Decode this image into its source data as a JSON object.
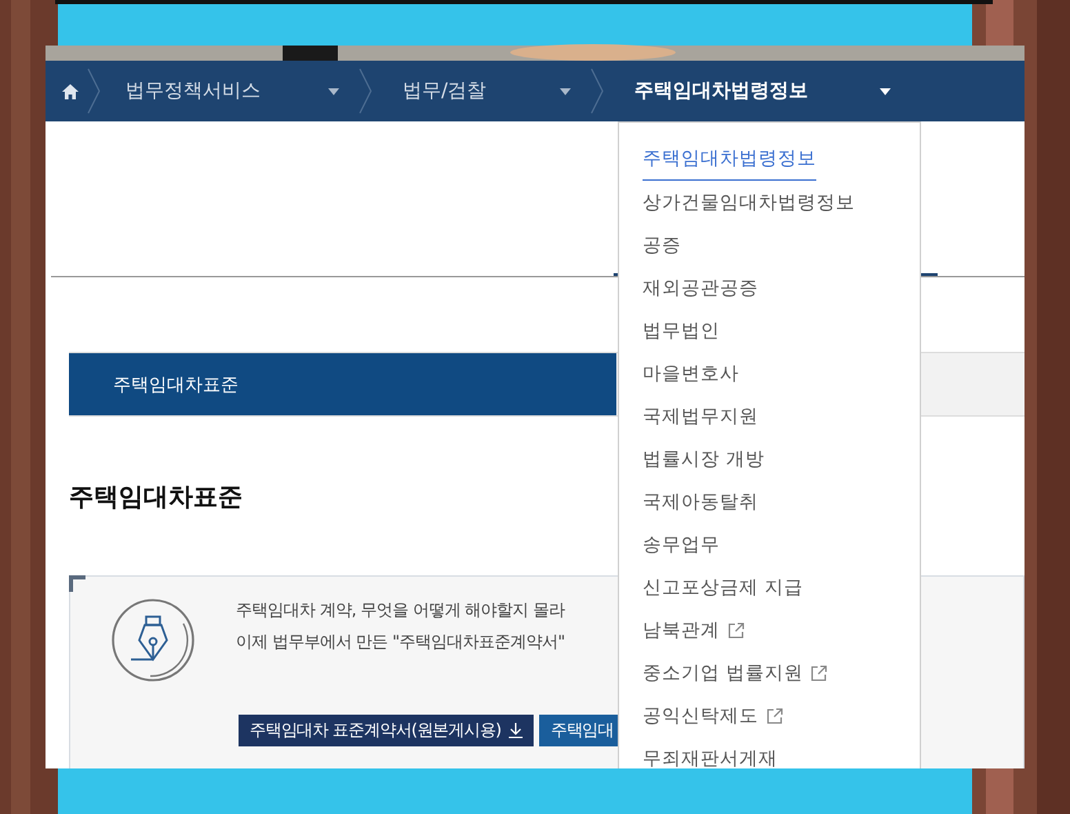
{
  "nav": {
    "items": [
      {
        "label": "법무정책서비스",
        "selected": false
      },
      {
        "label": "법무/검찰",
        "selected": false
      },
      {
        "label": "주택임대차법령정보",
        "selected": true
      }
    ]
  },
  "dropdown": {
    "items": [
      {
        "label": "주택임대차법령정보",
        "selected": true,
        "external": false
      },
      {
        "label": "상가건물임대차법령정보",
        "selected": false,
        "external": false
      },
      {
        "label": "공증",
        "selected": false,
        "external": false
      },
      {
        "label": "재외공관공증",
        "selected": false,
        "external": false
      },
      {
        "label": "법무법인",
        "selected": false,
        "external": false
      },
      {
        "label": "마을변호사",
        "selected": false,
        "external": false
      },
      {
        "label": "국제법무지원",
        "selected": false,
        "external": false
      },
      {
        "label": "법률시장 개방",
        "selected": false,
        "external": false
      },
      {
        "label": "국제아동탈취",
        "selected": false,
        "external": false
      },
      {
        "label": "송무업무",
        "selected": false,
        "external": false
      },
      {
        "label": "신고포상금제 지급",
        "selected": false,
        "external": false
      },
      {
        "label": "남북관계",
        "selected": false,
        "external": true
      },
      {
        "label": "중소기업 법률지원",
        "selected": false,
        "external": true
      },
      {
        "label": "공익신탁제도",
        "selected": false,
        "external": true
      },
      {
        "label": "무죄재판서게재",
        "selected": false,
        "external": false
      }
    ]
  },
  "tabs": [
    {
      "label": "주택임대차표준",
      "selected": true
    }
  ],
  "heading": "주택임대차표준",
  "info": {
    "lines": [
      "주택임대차 계약, 무엇을 어떻게 해야할지 몰라",
      "이제 법무부에서 만든 \"주택임대차표준계약서\""
    ],
    "buttons": [
      {
        "label": "주택임대차 표준계약서(원본게시용)",
        "kind": "download"
      },
      {
        "label": "주택임대",
        "kind": "plain"
      }
    ]
  }
}
